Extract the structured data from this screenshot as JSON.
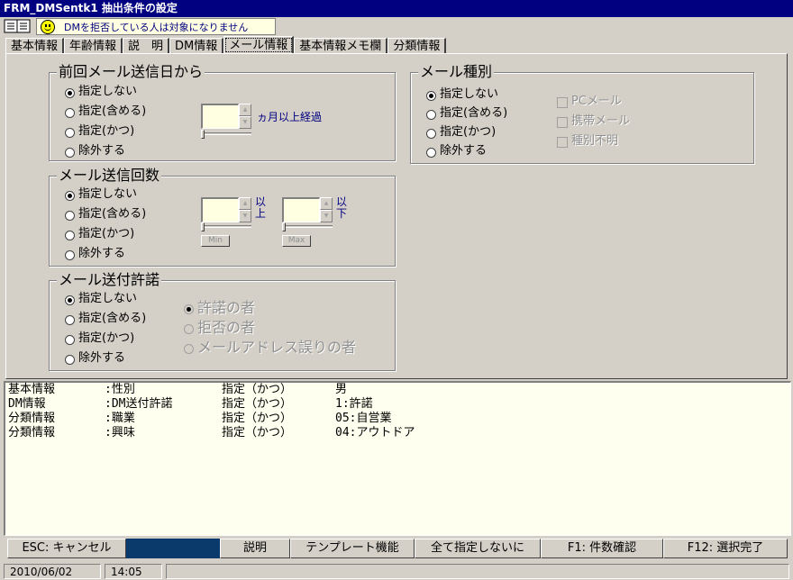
{
  "window": {
    "title": "FRM_DMSentk1 抽出条件の設定"
  },
  "notice": {
    "text": "DMを拒否している人は対象になりません"
  },
  "tabs": [
    {
      "label": "基本情報"
    },
    {
      "label": "年齢情報"
    },
    {
      "label": "説　明"
    },
    {
      "label": "DM情報"
    },
    {
      "label": "メール情報"
    },
    {
      "label": "基本情報メモ欄"
    },
    {
      "label": "分類情報"
    }
  ],
  "active_tab": "メール情報",
  "last_sent": {
    "title": "前回メール送信日から",
    "options": [
      "指定しない",
      "指定(含める)",
      "指定(かつ)",
      "除外する"
    ],
    "selected": "指定しない",
    "months_value": "",
    "months_suffix": "ヵ月以上経過"
  },
  "send_count": {
    "title": "メール送信回数",
    "options": [
      "指定しない",
      "指定(含める)",
      "指定(かつ)",
      "除外する"
    ],
    "selected": "指定しない",
    "min_value": "",
    "min_suffix": "以上",
    "max_value": "",
    "max_suffix": "以下",
    "min_button": "Min",
    "max_button": "Max"
  },
  "permission": {
    "title": "メール送付許諾",
    "options": [
      "指定しない",
      "指定(含める)",
      "指定(かつ)",
      "除外する"
    ],
    "selected": "指定しない",
    "sub_options": [
      "許諾の者",
      "拒否の者",
      "メールアドレス誤りの者"
    ]
  },
  "mail_type": {
    "title": "メール種別",
    "options": [
      "指定しない",
      "指定(含める)",
      "指定(かつ)",
      "除外する"
    ],
    "selected": "指定しない",
    "checkboxes": [
      "PCメール",
      "携帯メール",
      "種別不明"
    ]
  },
  "conditions": [
    {
      "category": "基本情報",
      "item": ":性別",
      "mode": "指定（かつ）",
      "value": "男"
    },
    {
      "category": "DM情報",
      "item": ":DM送付許諾",
      "mode": "指定（かつ）",
      "value": "1:許諾"
    },
    {
      "category": "分類情報",
      "item": ":職業",
      "mode": "指定（かつ）",
      "value": "05:自営業"
    },
    {
      "category": "分類情報",
      "item": ":興味",
      "mode": "指定（かつ）",
      "value": "04:アウトドア"
    }
  ],
  "fkeys": {
    "esc": "ESC: キャンセル",
    "help": "説明",
    "template": "テンプレート機能",
    "clear_all": "全て指定しないに",
    "f1": "F1: 件数確認",
    "f12": "F12: 選択完了"
  },
  "status": {
    "date": "2010/06/02",
    "time": "14:05"
  }
}
